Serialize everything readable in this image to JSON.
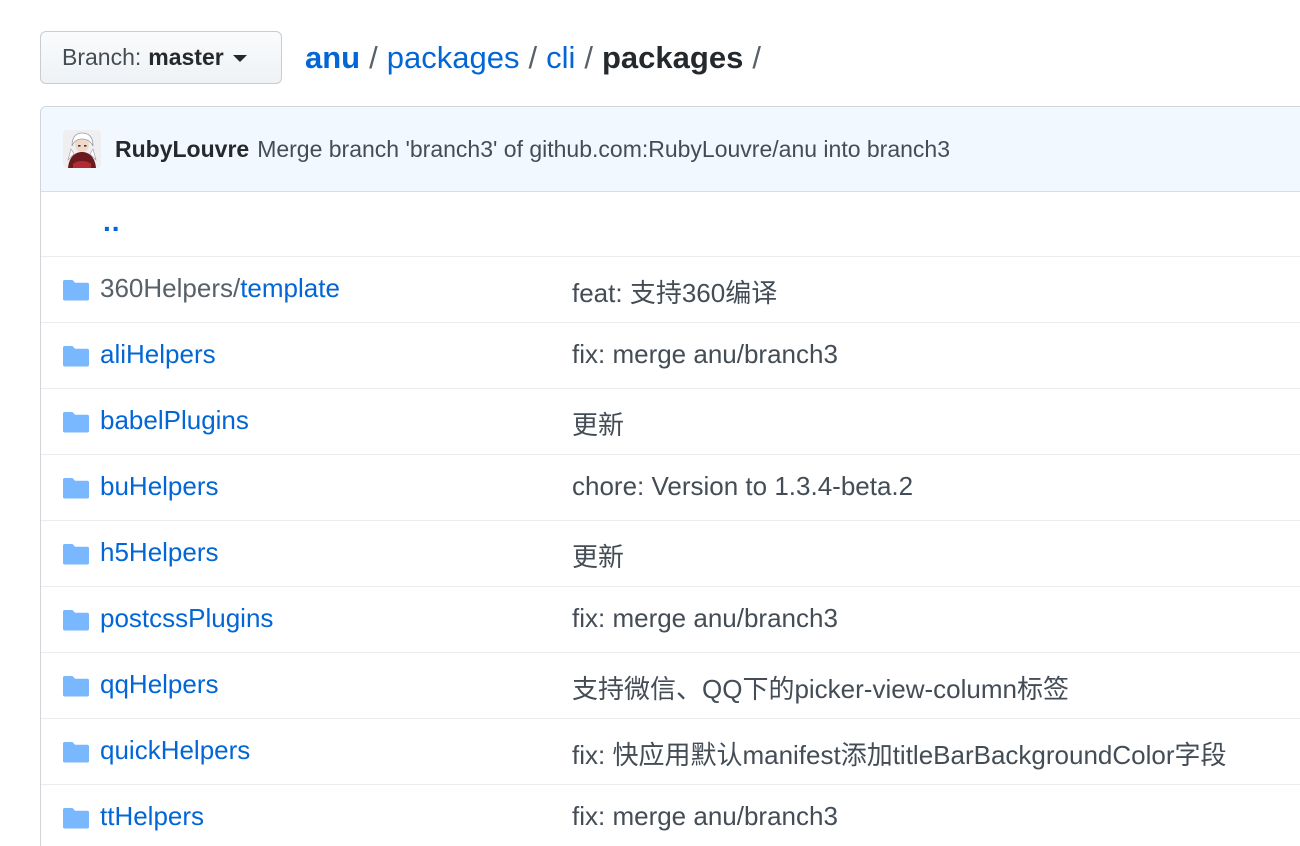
{
  "branch": {
    "prefix": "Branch:",
    "name": "master"
  },
  "breadcrumb": {
    "root": "anu",
    "segments": [
      "packages",
      "cli"
    ],
    "current": "packages",
    "separator": "/"
  },
  "commit": {
    "author": "RubyLouvre",
    "message": "Merge branch 'branch3' of github.com:RubyLouvre/anu into branch3"
  },
  "up_link": "..",
  "files": [
    {
      "prefix": "360Helpers/",
      "name": "template",
      "message": "feat: 支持360编译"
    },
    {
      "prefix": "",
      "name": "aliHelpers",
      "message": "fix: merge anu/branch3"
    },
    {
      "prefix": "",
      "name": "babelPlugins",
      "message": "更新"
    },
    {
      "prefix": "",
      "name": "buHelpers",
      "message": "chore: Version to 1.3.4-beta.2"
    },
    {
      "prefix": "",
      "name": "h5Helpers",
      "message": "更新"
    },
    {
      "prefix": "",
      "name": "postcssPlugins",
      "message": "fix: merge anu/branch3"
    },
    {
      "prefix": "",
      "name": "qqHelpers",
      "message": "支持微信、QQ下的picker-view-column标签"
    },
    {
      "prefix": "",
      "name": "quickHelpers",
      "message": "fix: 快应用默认manifest添加titleBarBackgroundColor字段"
    },
    {
      "prefix": "",
      "name": "ttHelpers",
      "message": "fix: merge anu/branch3"
    }
  ],
  "colors": {
    "link": "#0366d6",
    "folder_icon": "#79b8ff",
    "commit_bg": "#f1f8ff"
  },
  "icons": {
    "folder": "file-directory-icon",
    "avatar": "avatar"
  }
}
